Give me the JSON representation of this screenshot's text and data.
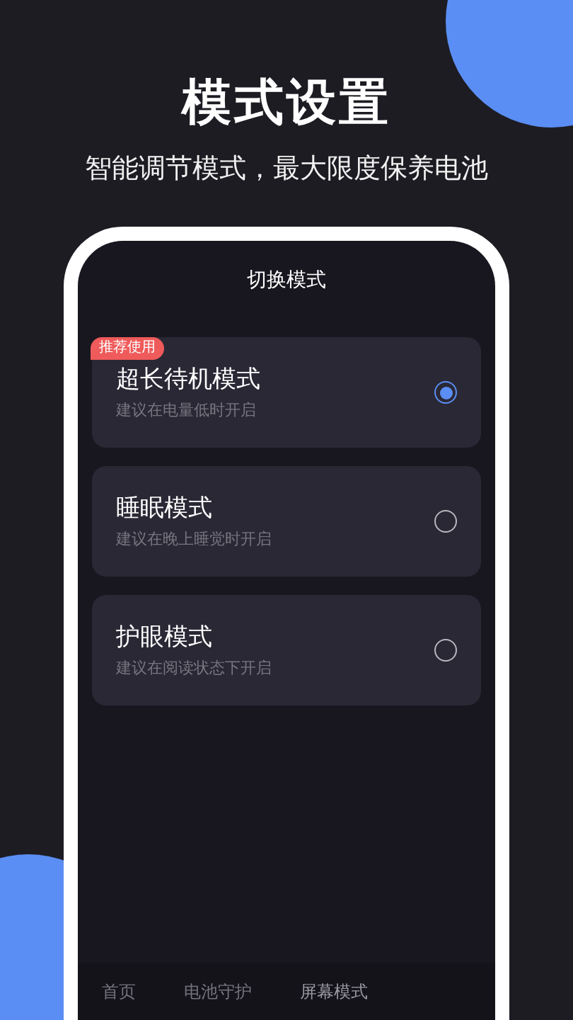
{
  "header": {
    "title": "模式设置",
    "subtitle": "智能调节模式，最大限度保养电池"
  },
  "screen": {
    "title": "切换模式",
    "modes": [
      {
        "name": "超长待机模式",
        "hint": "建议在电量低时开启",
        "badge": "推荐使用",
        "selected": true
      },
      {
        "name": "睡眠模式",
        "hint": "建议在晚上睡觉时开启",
        "selected": false
      },
      {
        "name": "护眼模式",
        "hint": "建议在阅读状态下开启",
        "selected": false
      }
    ],
    "tabs": [
      {
        "label": "首页",
        "selected": false
      },
      {
        "label": "电池守护",
        "selected": false
      },
      {
        "label": "屏幕模式",
        "selected": true
      }
    ]
  }
}
